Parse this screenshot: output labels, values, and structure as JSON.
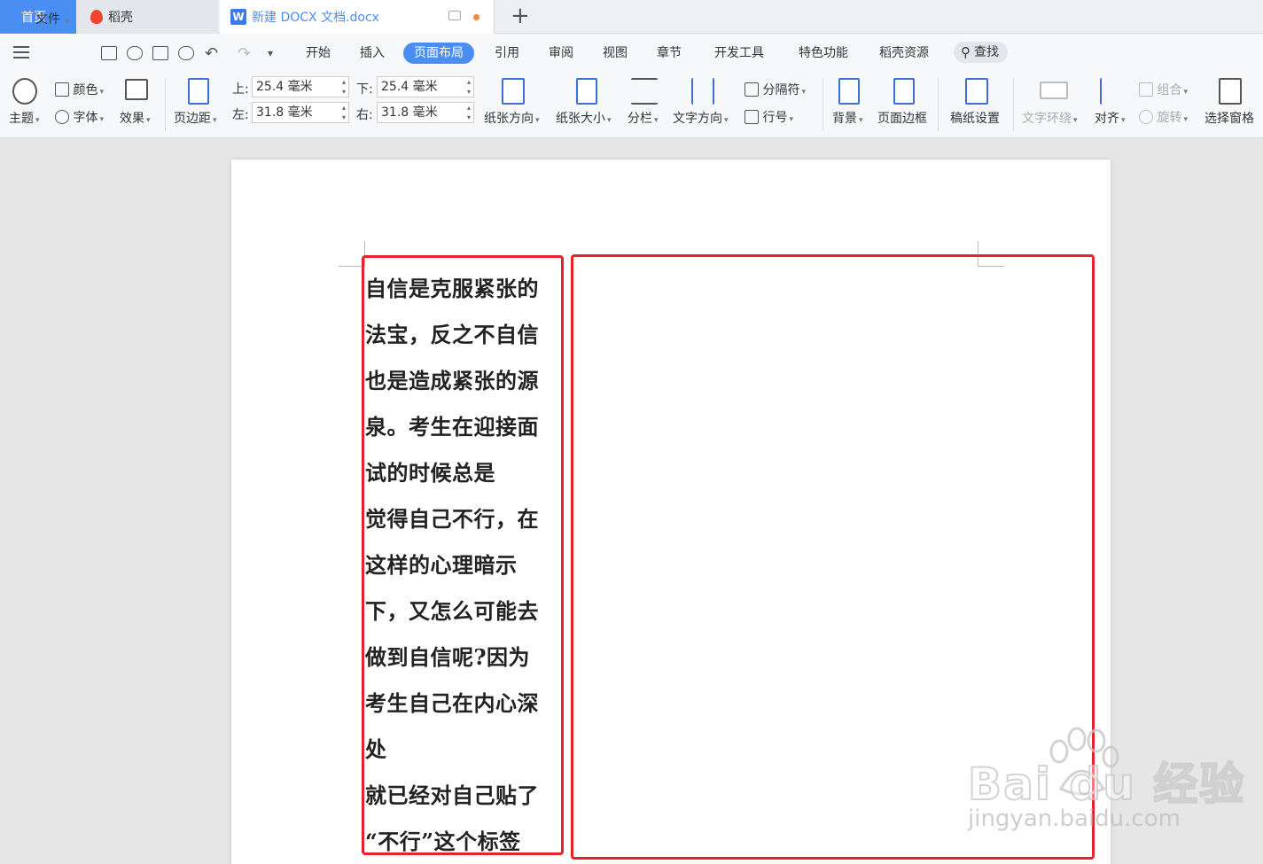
{
  "tabs": {
    "home": "首页",
    "daoke": "稻壳",
    "document": "新建 DOCX 文档.docx"
  },
  "menu": {
    "file": "文件",
    "items": [
      "开始",
      "插入",
      "页面布局",
      "引用",
      "审阅",
      "视图",
      "章节",
      "开发工具",
      "特色功能",
      "稻壳资源"
    ],
    "active": "页面布局",
    "search": "查找"
  },
  "ribbon": {
    "theme": "主题",
    "color": "颜色",
    "font": "字体",
    "effect": "效果",
    "margin": "页边距",
    "top_label": "上:",
    "top_value": "25.4 毫米",
    "bottom_label": "下:",
    "bottom_value": "25.4 毫米",
    "left_label": "左:",
    "left_value": "31.8 毫米",
    "right_label": "右:",
    "right_value": "31.8 毫米",
    "orientation": "纸张方向",
    "size": "纸张大小",
    "columns": "分栏",
    "text_direction": "文字方向",
    "separator": "分隔符",
    "line_number": "行号",
    "background": "背景",
    "page_border": "页面边框",
    "manuscript": "稿纸设置",
    "text_wrap": "文字环绕",
    "align": "对齐",
    "group": "组合",
    "rotate": "旋转",
    "select_pane": "选择窗格"
  },
  "document": {
    "lines": [
      "自信是克服紧张的",
      "法宝，反之不自信",
      "也是造成紧张的源",
      "泉。考生在迎接面",
      "试的时候总是",
      "觉得自己不行，在",
      "这样的心理暗示",
      "下，又怎么可能去",
      "做到自信呢?因为",
      "考生自己在内心深",
      "处",
      "就已经对自己贴了",
      "“不行”这个标签"
    ]
  },
  "watermark": {
    "main": "Bai du 经验",
    "sub": "jingyan.baidu.com"
  },
  "colors": {
    "accent": "#4a8ef3",
    "highlight_box": "#e8222a"
  }
}
